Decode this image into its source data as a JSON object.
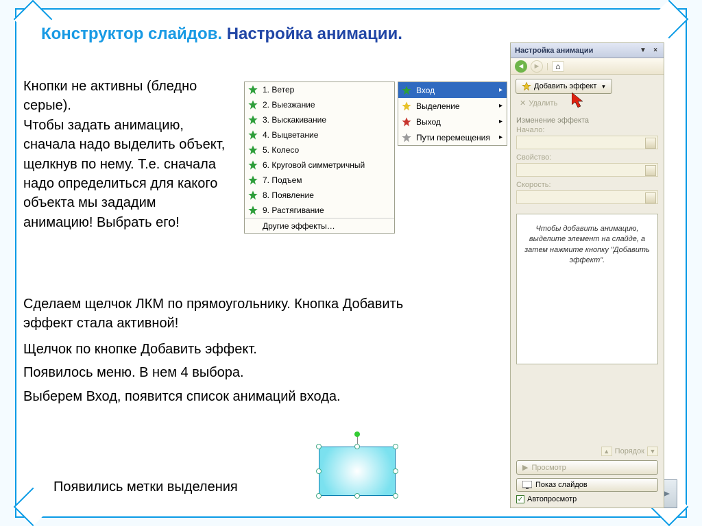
{
  "title": {
    "left": "Конструктор слайдов.",
    "right": "Настройка анимации."
  },
  "body": {
    "p1": "Кнопки не активны (бледно серые).\nЧтобы задать анимацию, сначала надо выделить объект, щелкнув по нему. Т.е. сначала надо определиться для какого объекта мы зададим анимацию! Выбрать его!",
    "p2": "Сделаем щелчок ЛКМ по прямоугольнику. Кнопка Добавить эффект стала активной!",
    "p3": "Щелчок по кнопке Добавить эффект.",
    "p4": "Появилось меню. В нем 4 выбора.",
    "p5": "Выберем Вход, появится список анимаций входа.",
    "sel_label": "Появились метки выделения"
  },
  "effects": {
    "items": [
      "1. Ветер",
      "2. Выезжание",
      "3. Выскакивание",
      "4. Выцветание",
      "5. Колесо",
      "6. Круговой симметричный",
      "7. Подъем",
      "8. Появление",
      "9. Растягивание"
    ],
    "more": "Другие эффекты…"
  },
  "cat": {
    "items": [
      "Вход",
      "Выделение",
      "Выход",
      "Пути перемещения"
    ],
    "star_colors": [
      "#2e9e3a",
      "#e8c22a",
      "#c7352d",
      "#9a9a9a"
    ]
  },
  "pane": {
    "title": "Настройка анимации",
    "add": "Добавить эффект",
    "del": "Удалить",
    "change": "Изменение эффекта",
    "f1": "Начало:",
    "f2": "Свойство:",
    "f3": "Скорость:",
    "hint": "Чтобы добавить анимацию, выделите элемент на слайде, а затем нажмите кнопку \"Добавить эффект\".",
    "order": "Порядок",
    "preview": "Просмотр",
    "show": "Показ слайдов",
    "auto": "Автопросмотр"
  }
}
